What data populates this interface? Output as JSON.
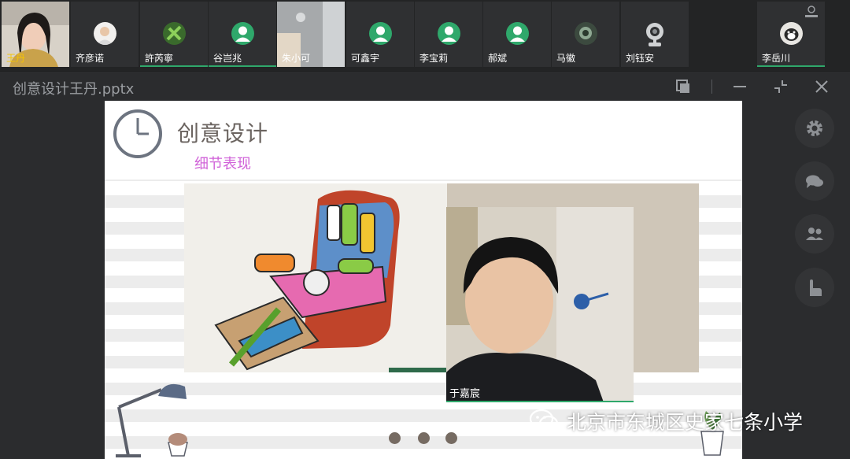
{
  "participants": [
    {
      "name": "王丹",
      "type": "video",
      "speaking": true
    },
    {
      "name": "齐彦诺",
      "type": "avatar"
    },
    {
      "name": "許芮寧",
      "type": "avatar"
    },
    {
      "name": "谷岂兆",
      "type": "default"
    },
    {
      "name": "朱小可",
      "type": "video"
    },
    {
      "name": "可鑫宇",
      "type": "default"
    },
    {
      "name": "李宝莉",
      "type": "default"
    },
    {
      "name": "郝斌",
      "type": "default"
    },
    {
      "name": "马徽",
      "type": "avatar"
    },
    {
      "name": "刘钰安",
      "type": "camera"
    },
    {
      "name": "李岳川",
      "type": "avatar"
    }
  ],
  "window": {
    "title": "创意设计王丹.pptx"
  },
  "slide": {
    "title": "创意设计",
    "subtitle": "细节表现",
    "student_name": "于嘉宸",
    "dots": 3
  },
  "watermark": {
    "text": "北京市东城区史家七条小学"
  },
  "sidebar": {
    "buttons": [
      "settings-icon",
      "chat-icon",
      "participants-icon",
      "raise-hand-icon"
    ]
  },
  "colors": {
    "accent_green": "#2fa86b",
    "speaking_yellow": "#f5c400",
    "subtitle_pink": "#d061d8",
    "slide_title": "#6b6460"
  }
}
